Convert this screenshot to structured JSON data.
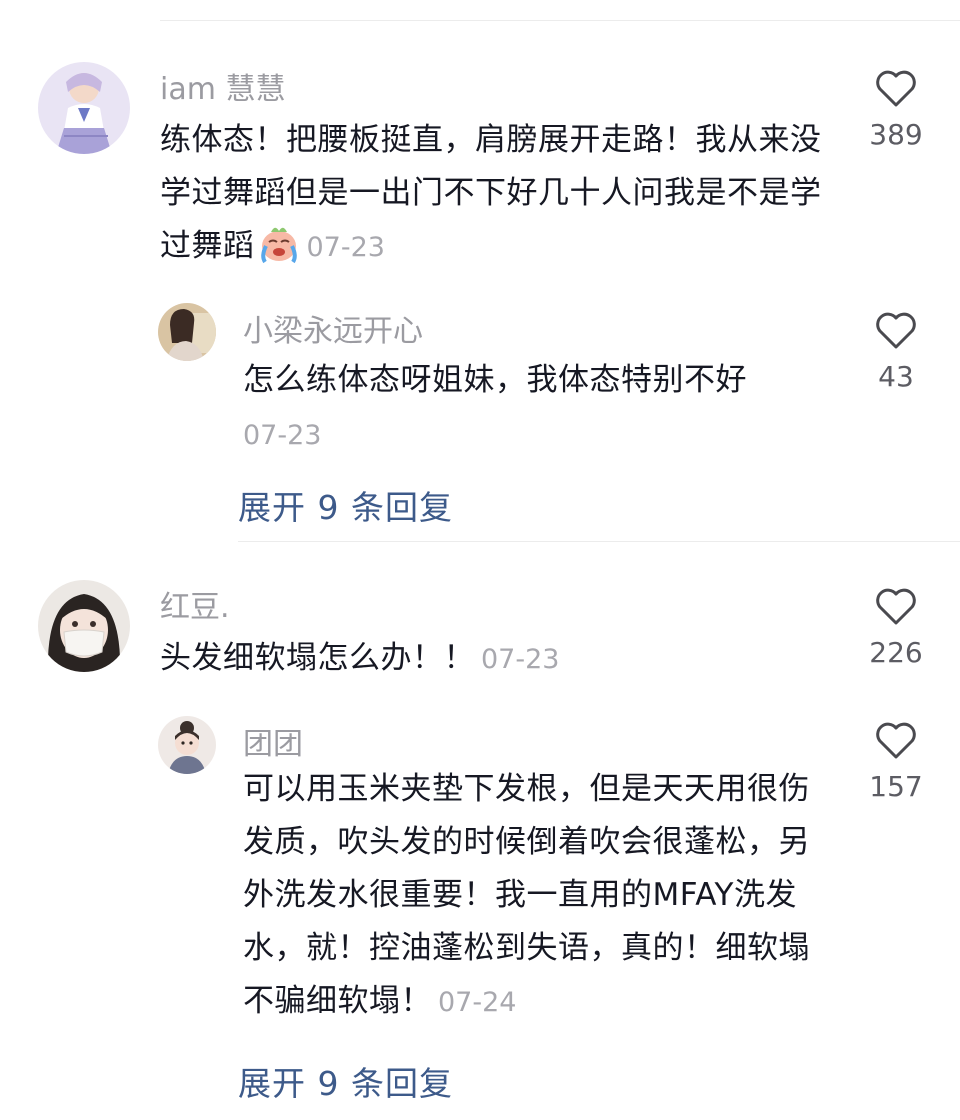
{
  "comments": [
    {
      "username": "iam 慧慧",
      "text": "练体态！把腰板挺直，肩膀展开走路！我从来没学过舞蹈但是一出门不下好几十人问我是不是学过舞蹈",
      "date": "07-23",
      "likes": "389",
      "emoji_icon": "crying-face-icon",
      "reply": {
        "username": "小梁永远开心",
        "text": "怎么练体态呀姐妹，我体态特别不好",
        "date": "07-23",
        "likes": "43"
      },
      "expand_label": "展开 9 条回复"
    },
    {
      "username": "红豆.",
      "text": "头发细软塌怎么办！！",
      "date": "07-23",
      "likes": "226",
      "reply": {
        "username": "团团",
        "text": "可以用玉米夹垫下发根，但是天天用很伤发质，吹头发的时候倒着吹会很蓬松，另外洗发水很重要！我一直用的MFAY洗发水，就！控油蓬松到失语，真的！细软塌不骗细软塌！",
        "date": "07-24",
        "likes": "157"
      },
      "expand_label": "展开 9 条回复"
    }
  ],
  "colors": {
    "username": "#9b9ba1",
    "text": "#161823",
    "date": "#a8a8ae",
    "link": "#3d5a8a",
    "heart": "#4a4a4f"
  }
}
